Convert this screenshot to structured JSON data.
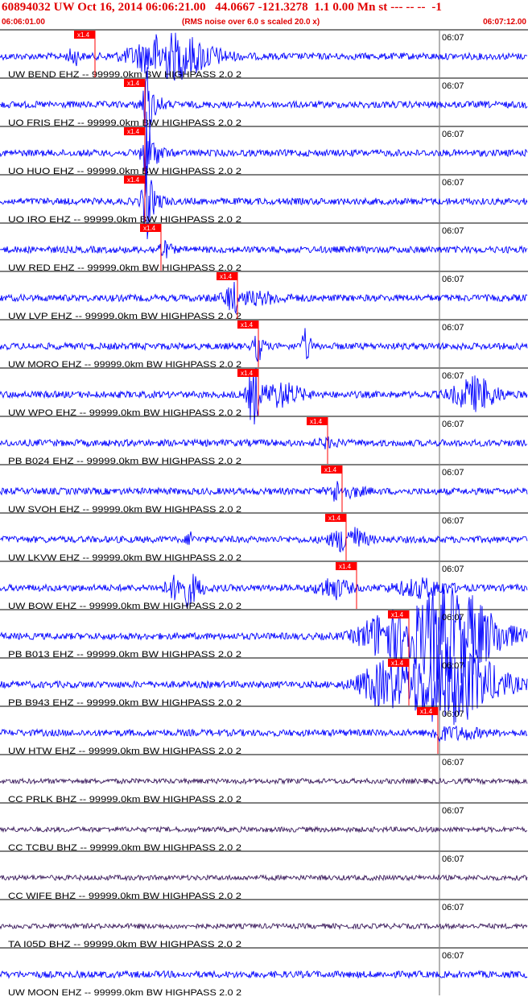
{
  "header": {
    "title": "60894032 UW Oct 16, 2014 06:06:21.00   44.0667 -121.3278  1.1 0.00 Mn st --- -- --  -1",
    "start_time": "06:06:01.00",
    "rms_note": "(RMS noise over 6.0 s scaled 20.0 x)",
    "end_time": "06:07:12.00"
  },
  "minute_label": "06:07",
  "pick_label": "x1.4",
  "colors": {
    "title_red": "#e00000",
    "trace_blue": "#0000ff",
    "trace_purple": "#3a1a5c",
    "pick_red": "#ff0000",
    "grid_line": "#000000"
  },
  "traces": [
    {
      "label": "UW BEND EHZ -- 99999.0km BW  HIGHPASS  2.0  2",
      "color": "blue",
      "pick": 0.18
    },
    {
      "label": "UO FRIS EHZ -- 99999.0km BW  HIGHPASS  2.0  2",
      "color": "blue",
      "pick": 0.275
    },
    {
      "label": "UO HUO EHZ -- 99999.0km BW  HIGHPASS  2.0  2",
      "color": "blue",
      "pick": 0.275
    },
    {
      "label": "UO IRO EHZ -- 99999.0km BW  HIGHPASS  2.0  2",
      "color": "blue",
      "pick": 0.275
    },
    {
      "label": "UW RED EHZ -- 99999.0km BW  HIGHPASS  2.0  2",
      "color": "blue",
      "pick": 0.305
    },
    {
      "label": "UW LVP EHZ -- 99999.0km BW  HIGHPASS  2.0  2",
      "color": "blue",
      "pick": 0.45
    },
    {
      "label": "UW MORO EHZ -- 99999.0km BW  HIGHPASS  2.0  2",
      "color": "blue",
      "pick": 0.49
    },
    {
      "label": "UW WPO EHZ -- 99999.0km BW  HIGHPASS  2.0  2",
      "color": "blue",
      "pick": 0.49
    },
    {
      "label": "PB B024 EHZ -- 99999.0km BW  HIGHPASS  2.0  2",
      "color": "blue",
      "pick": 0.62
    },
    {
      "label": "UW SVOH EHZ -- 99999.0km BW  HIGHPASS  2.0  2",
      "color": "blue",
      "pick": 0.648
    },
    {
      "label": "UW LKVW EHZ -- 99999.0km BW  HIGHPASS  2.0  2",
      "color": "blue",
      "pick": 0.655
    },
    {
      "label": "UW BOW EHZ -- 99999.0km BW  HIGHPASS  2.0  2",
      "color": "blue",
      "pick": 0.675
    },
    {
      "label": "PB B013 EHZ -- 99999.0km BW  HIGHPASS  2.0  2",
      "color": "blue",
      "pick": 0.775
    },
    {
      "label": "PB B943 EHZ -- 99999.0km BW  HIGHPASS  2.0  2",
      "color": "blue",
      "pick": 0.775
    },
    {
      "label": "UW HTW EHZ -- 99999.0km BW  HIGHPASS  2.0  2",
      "color": "blue",
      "pick": 0.83
    },
    {
      "label": "CC PRLK BHZ -- 99999.0km BW  HIGHPASS  2.0  2",
      "color": "purple",
      "pick": null
    },
    {
      "label": "CC TCBU BHZ -- 99999.0km BW  HIGHPASS  2.0  2",
      "color": "purple",
      "pick": null
    },
    {
      "label": "CC WIFE BHZ -- 99999.0km BW  HIGHPASS  2.0  2",
      "color": "purple",
      "pick": null
    },
    {
      "label": "TA I05D BHZ -- 99999.0km BW  HIGHPASS  2.0  2",
      "color": "purple",
      "pick": null
    },
    {
      "label": "UW MOON EHZ -- 99999.0km BW  HIGHPASS  2.0  2",
      "color": "blue",
      "pick": null
    }
  ]
}
